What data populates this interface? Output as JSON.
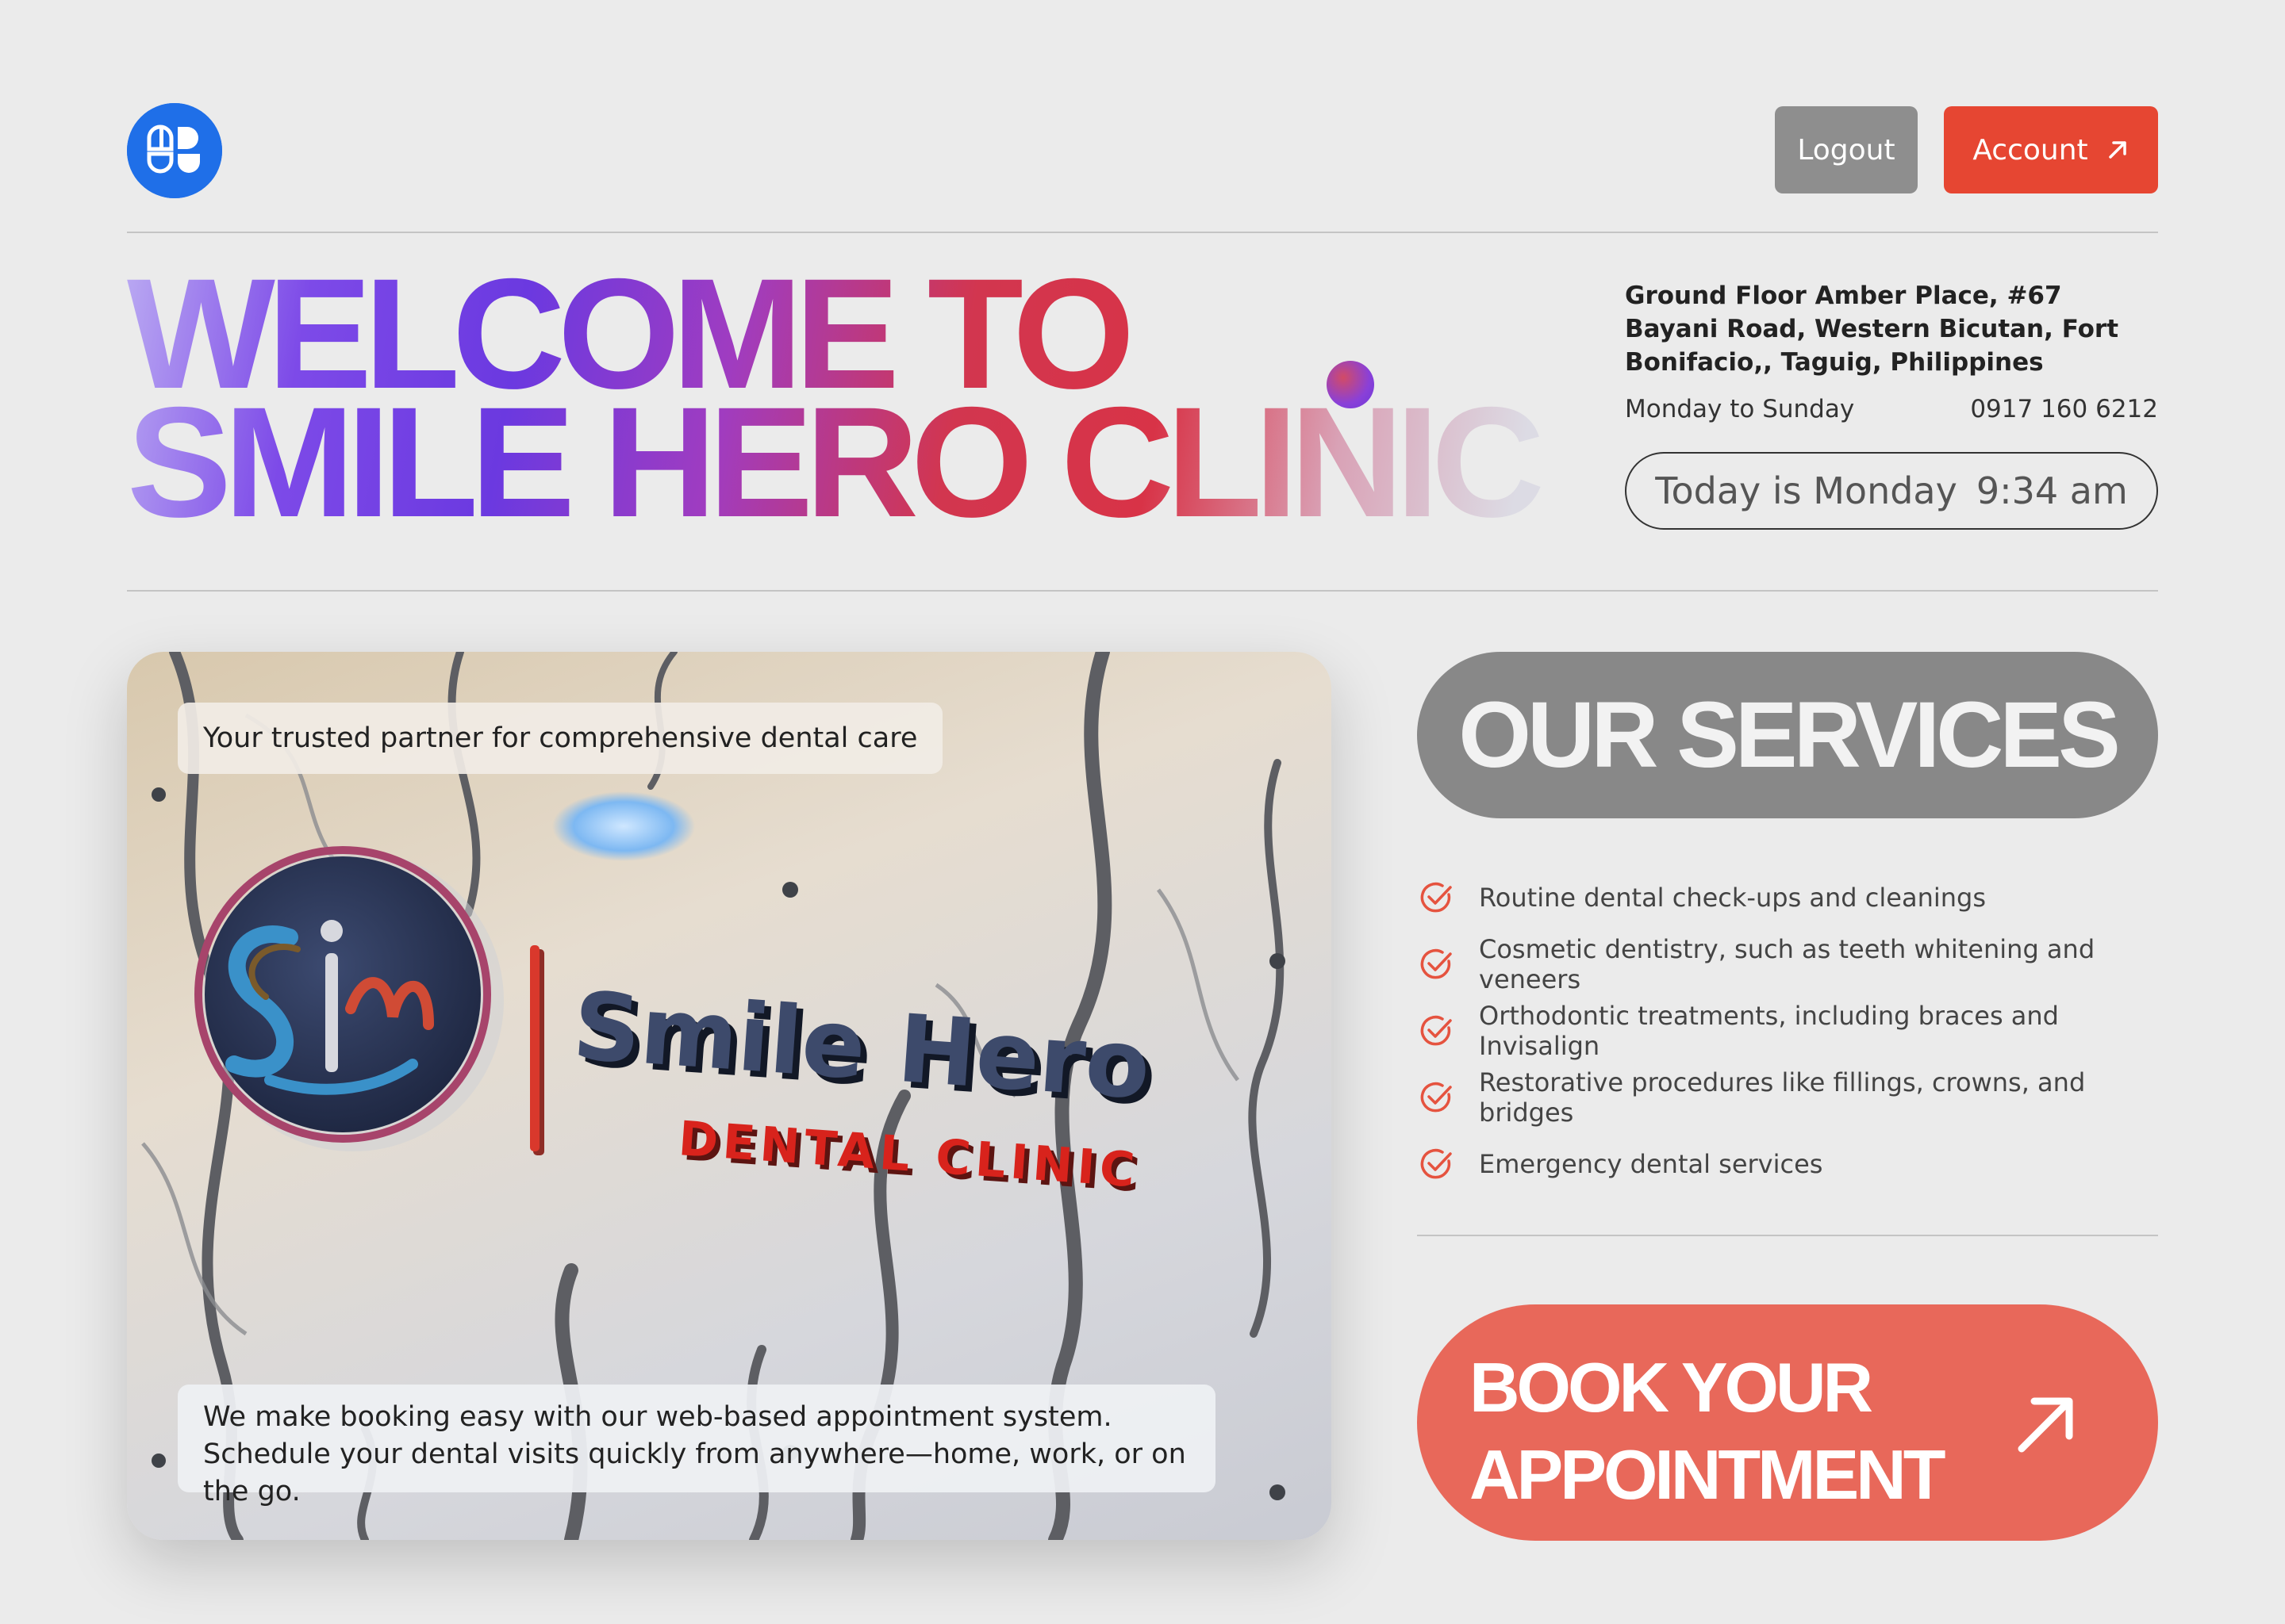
{
  "header": {
    "logout_label": "Logout",
    "account_label": "Account"
  },
  "hero": {
    "title_line1": "WELCOME TO",
    "title_line2": "SMILE HERO CLINIC"
  },
  "clinic_info": {
    "address": "Ground Floor Amber Place, #67 Bayani Road, Western Bicutan, Fort Bonifacio,, Taguig, Philippines",
    "hours": "Monday to Sunday",
    "phone": "0917 160 6212",
    "today_label": "Today is Monday",
    "time": "9:34 am"
  },
  "photo_card": {
    "tagline": "Your trusted partner for comprehensive dental care",
    "booking_text": "We make booking easy with our web-based appointment system. Schedule your dental visits quickly from anywhere—home, work, or on the go.",
    "sign_title": "Smile Hero",
    "sign_subtitle": "DENTAL CLINIC"
  },
  "services": {
    "title": "OUR SERVICES",
    "items": [
      "Routine dental check-ups and cleanings",
      "Cosmetic dentistry, such as teeth whitening and veneers",
      "Orthodontic treatments, including braces and Invisalign",
      "Restorative procedures like fillings, crowns, and bridges",
      "Emergency dental services"
    ]
  },
  "cta": {
    "line1": "BOOK YOUR",
    "line2": "APPOINTMENT"
  },
  "colors": {
    "accent_red": "#e64632",
    "cta_coral": "#e8685a",
    "logo_blue": "#1f6fe8",
    "neutral_gray": "#888888",
    "background": "#ebebeb"
  },
  "icons": {
    "logo": "brand-logo-icon",
    "account_arrow": "arrow-up-right-icon",
    "service_check": "check-circle-icon",
    "cta_arrow": "arrow-up-right-icon"
  }
}
